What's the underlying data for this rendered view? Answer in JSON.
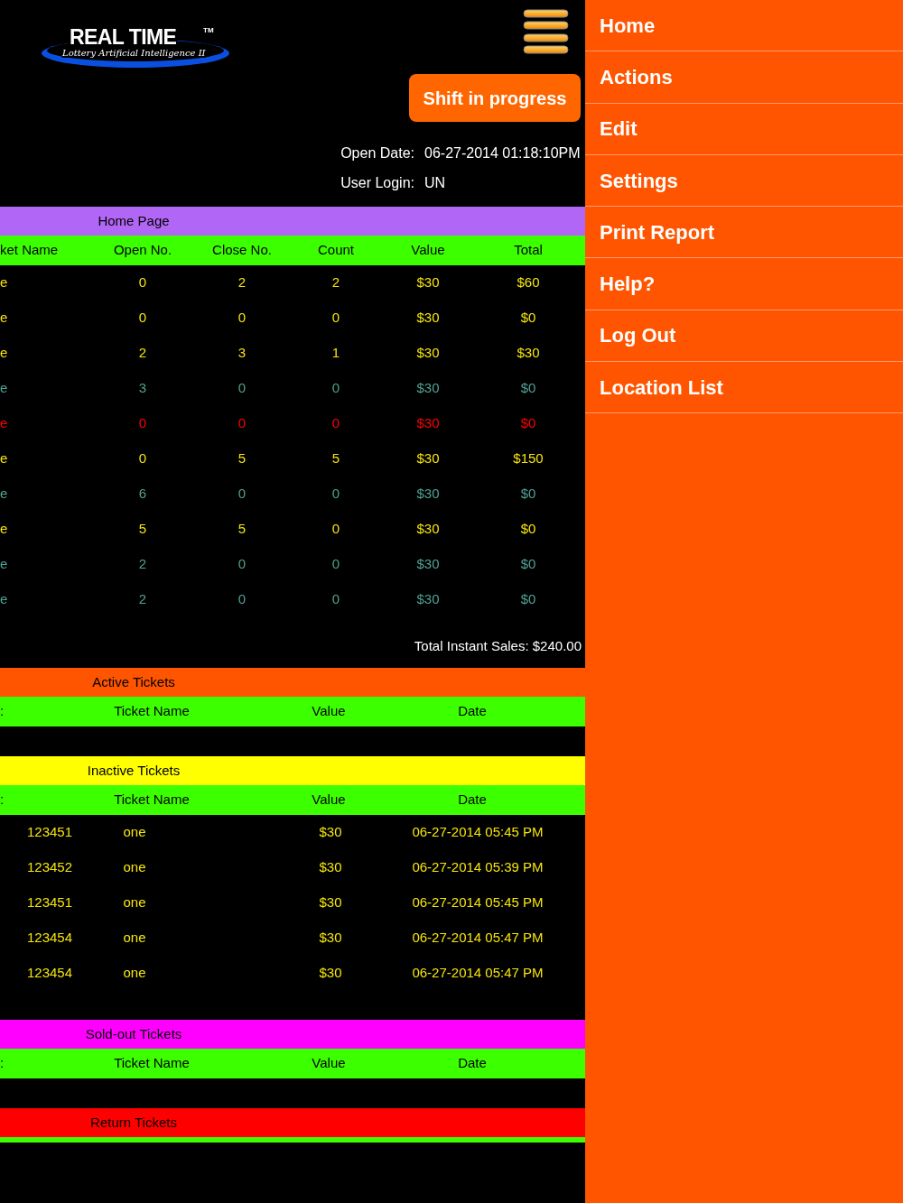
{
  "logo": {
    "title": "REAL TIME",
    "trademark": "TM",
    "subtitle": "Lottery Artificial Intelligence II"
  },
  "shift_button": "Shift in progress",
  "info": [
    {
      "label": "Open Date:",
      "value": "06-27-2014 01:18:10PM"
    },
    {
      "label": "User Login:",
      "value": "UN"
    }
  ],
  "home_table": {
    "title": "Home Page",
    "columns": [
      "ket Name",
      "Open No.",
      "Close No.",
      "Count",
      "Value",
      "Total"
    ],
    "rows": [
      {
        "color": "#f5e50a",
        "cells": [
          "e",
          "0",
          "2",
          "2",
          "$30",
          "$60"
        ]
      },
      {
        "color": "#f5e50a",
        "cells": [
          "e",
          "0",
          "0",
          "0",
          "$30",
          "$0"
        ]
      },
      {
        "color": "#f5e50a",
        "cells": [
          "e",
          "2",
          "3",
          "1",
          "$30",
          "$30"
        ]
      },
      {
        "color": "#4fa394",
        "cells": [
          "e",
          "3",
          "0",
          "0",
          "$30",
          "$0"
        ]
      },
      {
        "color": "#ff0000",
        "cells": [
          "e",
          "0",
          "0",
          "0",
          "$30",
          "$0"
        ]
      },
      {
        "color": "#f5e50a",
        "cells": [
          "e",
          "0",
          "5",
          "5",
          "$30",
          "$150"
        ]
      },
      {
        "color": "#4fa394",
        "cells": [
          "e",
          "6",
          "0",
          "0",
          "$30",
          "$0"
        ]
      },
      {
        "color": "#f5e50a",
        "cells": [
          "e",
          "5",
          "5",
          "0",
          "$30",
          "$0"
        ]
      },
      {
        "color": "#4fa394",
        "cells": [
          "e",
          "2",
          "0",
          "0",
          "$30",
          "$0"
        ]
      },
      {
        "color": "#4fa394",
        "cells": [
          "e",
          "2",
          "0",
          "0",
          "$30",
          "$0"
        ]
      }
    ],
    "total": "Total Instant Sales: $240.00"
  },
  "ticket_sections": [
    {
      "title": "Active Tickets",
      "color": "#ff5500",
      "columns": [
        ":",
        "Ticket Name",
        "Value",
        "Date"
      ]
    },
    {
      "title": "Inactive Tickets",
      "color": "#ffff00",
      "columns": [
        ":",
        "Ticket Name",
        "Value",
        "Date"
      ],
      "rows": [
        [
          "123451",
          "one",
          "$30",
          "06-27-2014 05:45 PM"
        ],
        [
          "123452",
          "one",
          "$30",
          "06-27-2014 05:39 PM"
        ],
        [
          "123451",
          "one",
          "$30",
          "06-27-2014 05:45 PM"
        ],
        [
          "123454",
          "one",
          "$30",
          "06-27-2014 05:47 PM"
        ],
        [
          "123454",
          "one",
          "$30",
          "06-27-2014 05:47 PM"
        ]
      ]
    },
    {
      "title": "Sold-out Tickets",
      "color": "#ff00ff",
      "columns": [
        ":",
        "Ticket Name",
        "Value",
        "Date"
      ]
    },
    {
      "title": "Return Tickets",
      "color": "#ff0000"
    }
  ],
  "menu": [
    "Home",
    "Actions",
    "Edit",
    "Settings",
    "Print Report",
    "Help?",
    "Log Out",
    "Location List"
  ]
}
